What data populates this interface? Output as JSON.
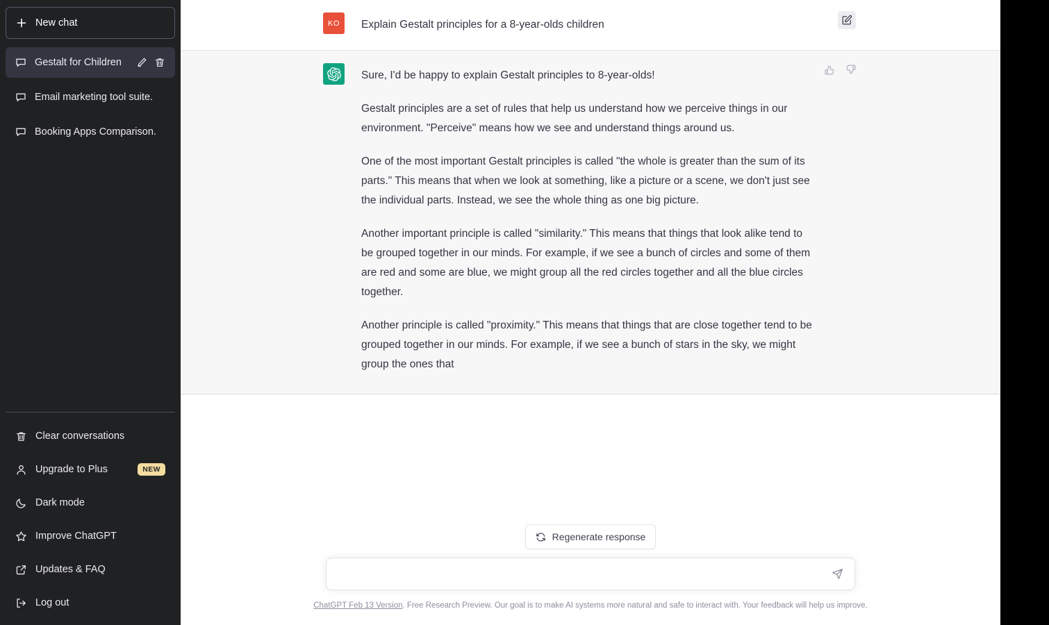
{
  "sidebar": {
    "new_chat": {
      "label": "New chat",
      "icon": "plus-icon"
    },
    "conversations": [
      {
        "label": "Gestalt for Children",
        "icon": "chat-bubble-icon",
        "active": true,
        "edit_icon": "pencil-icon",
        "delete_icon": "trash-icon"
      },
      {
        "label": "Email marketing tool suite.",
        "icon": "chat-bubble-icon",
        "active": false
      },
      {
        "label": "Booking Apps Comparison.",
        "icon": "chat-bubble-icon",
        "active": false
      }
    ],
    "bottom_items": [
      {
        "label": "Clear conversations",
        "icon": "trash-icon"
      },
      {
        "label": "Upgrade to Plus",
        "icon": "person-icon",
        "badge": "NEW"
      },
      {
        "label": "Dark mode",
        "icon": "moon-icon"
      },
      {
        "label": "Improve ChatGPT",
        "icon": "star-icon"
      },
      {
        "label": "Updates & FAQ",
        "icon": "external-link-icon"
      },
      {
        "label": "Log out",
        "icon": "logout-icon"
      }
    ]
  },
  "conversation": {
    "user_message": {
      "avatar_initials": "KO",
      "avatar_color": "#e8503a",
      "text": "Explain Gestalt principles for a 8-year-olds children",
      "edit_icon": "pencil-square-icon"
    },
    "assistant_message": {
      "avatar_color": "#10a37f",
      "avatar_icon": "openai-logo-icon",
      "paragraphs": [
        "Sure, I'd be happy to explain Gestalt principles to 8-year-olds!",
        "Gestalt principles are a set of rules that help us understand how we perceive things in our environment. \"Perceive\" means how we see and understand things around us.",
        "One of the most important Gestalt principles is called \"the whole is greater than the sum of its parts.\" This means that when we look at something, like a picture or a scene, we don't just see the individual parts. Instead, we see the whole thing as one big picture.",
        "Another important principle is called \"similarity.\" This means that things that look alike tend to be grouped together in our minds. For example, if we see a bunch of circles and some of them are red and some are blue, we might group all the red circles together and all the blue circles together.",
        "Another principle is called \"proximity.\" This means that things that are close together tend to be grouped together in our minds. For example, if we see a bunch of stars in the sky, we might group the ones that"
      ],
      "thumbs_up_icon": "thumbs-up-icon",
      "thumbs_down_icon": "thumbs-down-icon"
    }
  },
  "composer": {
    "regenerate_label": "Regenerate response",
    "regenerate_icon": "refresh-icon",
    "input_value": "",
    "input_placeholder": "",
    "send_icon": "send-icon"
  },
  "footer": {
    "link_text": "ChatGPT Feb 13 Version",
    "rest_text": ". Free Research Preview. Our goal is to make AI systems more natural and safe to interact with. Your feedback will help us improve."
  }
}
